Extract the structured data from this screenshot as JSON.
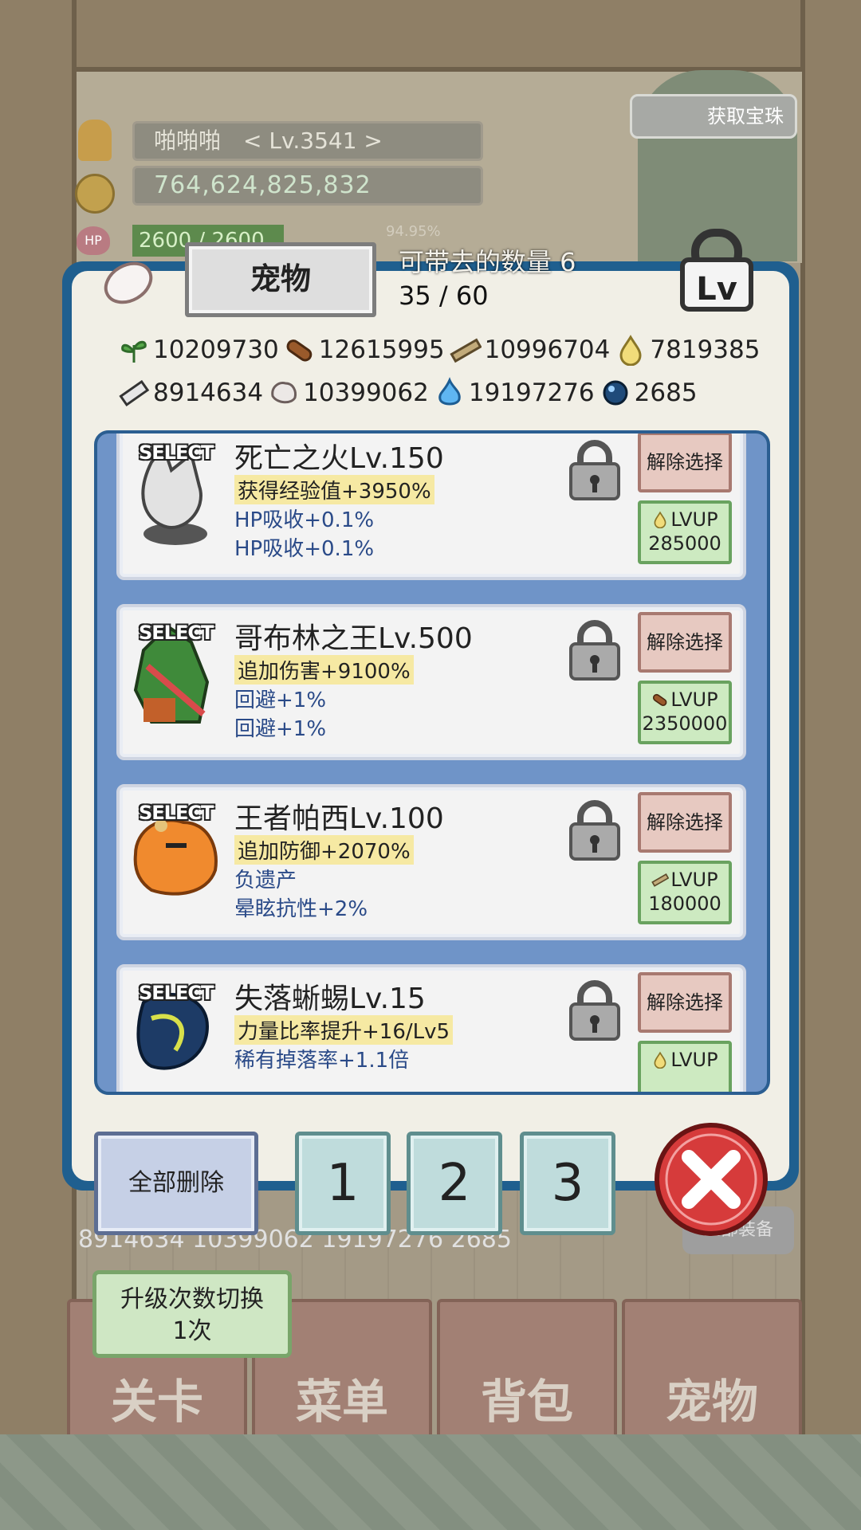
{
  "player": {
    "name_level": "啪啪啪　< Lv.3541 >",
    "gold": "764,624,825,832",
    "hp": "2600 / 2600",
    "exp_percent": "94.95%",
    "gem_button": "获取宝珠"
  },
  "modal": {
    "tab_title": "宠物",
    "capacity_label": "可带去的数量 6",
    "capacity_count": "35 / 60"
  },
  "resources": [
    {
      "icon": "herb-icon",
      "value": "10209730"
    },
    {
      "icon": "wood-log-icon",
      "value": "12615995"
    },
    {
      "icon": "plank-icon",
      "value": "10996704"
    },
    {
      "icon": "gold-drop-icon",
      "value": "7819385"
    },
    {
      "icon": "iron-ingot-icon",
      "value": "8914634"
    },
    {
      "icon": "stone-icon",
      "value": "10399062"
    },
    {
      "icon": "blue-flame-icon",
      "value": "19197276"
    },
    {
      "icon": "blue-orb-icon",
      "value": "2685"
    }
  ],
  "pets": [
    {
      "select": "SELECT",
      "name": "死亡之火Lv.150",
      "main": "获得经验值+3950%",
      "sub1": "HP吸收+0.1%",
      "sub2": "HP吸收+0.1%",
      "deselect": "解除选择",
      "lvup": "LVUP",
      "cost": "285000",
      "cost_icon": "gold-drop-icon"
    },
    {
      "select": "SELECT",
      "name": "哥布林之王Lv.500",
      "main": "追加伤害+9100%",
      "sub1": "回避+1%",
      "sub2": "回避+1%",
      "deselect": "解除选择",
      "lvup": "LVUP",
      "cost": "2350000",
      "cost_icon": "wood-log-icon"
    },
    {
      "select": "SELECT",
      "name": "王者帕西Lv.100",
      "main": "追加防御+2070%",
      "sub1": "负遗产",
      "sub2": "晕眩抗性+2%",
      "deselect": "解除选择",
      "lvup": "LVUP",
      "cost": "180000",
      "cost_icon": "plank-icon"
    },
    {
      "select": "SELECT",
      "name": "失落蜥蜴Lv.15",
      "main": "力量比率提升+16/Lv5",
      "sub1": "稀有掉落率+1.1倍",
      "sub2": "",
      "deselect": "解除选择",
      "lvup": "LVUP",
      "cost": "",
      "cost_icon": "gold-drop-icon"
    }
  ],
  "bottom_bar": {
    "delete_all": "全部删除",
    "slot1": "1",
    "slot2": "2",
    "slot3": "3"
  },
  "background": {
    "resources_row": "8914634  10399062  19197276  2685",
    "equip_all": "全部装备",
    "upgrade_toggle_line1": "升级次数切换",
    "upgrade_toggle_line2": "1次",
    "nav": [
      "关卡",
      "菜单",
      "背包",
      "宠物"
    ]
  }
}
